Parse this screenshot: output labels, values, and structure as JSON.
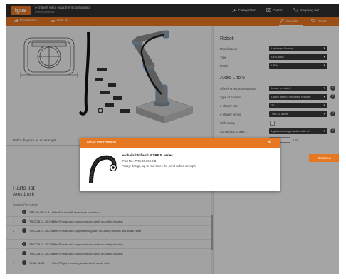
{
  "header": {
    "logo": "igus",
    "title": "e-chain® robot equipment configurator",
    "subtitle": "motion plastics®",
    "links": [
      {
        "icon": "wrench-icon",
        "label": "Configuration"
      },
      {
        "icon": "mail-icon",
        "label": "Contact"
      },
      {
        "icon": "cart-icon",
        "label": "Shopping cart"
      }
    ],
    "menu_icon": "⋮"
  },
  "toolbar": {
    "visualisation": "Visualisation",
    "parts_list": "Parts list",
    "selection": "Selection",
    "result": "Result"
  },
  "left": {
    "diagram_caption": "Robot diagram as an example",
    "parts_title": "Parts list",
    "parts_subtitle": "Axes 1 to 6",
    "table_header": "Quantity Part number",
    "rows": [
      {
        "qty": "1",
        "part": "TRE.30.090.0.B",
        "desc": "triflex® e-chain® resistance to torsion",
        "size": "two"
      },
      {
        "qty": "1",
        "part": "TR.COB.01.30.22.0",
        "desc": "triflex® hook-and-loop connection with mounting bracket"
      },
      {
        "qty": "2",
        "part": "TR.COB.01.30.22.0",
        "desc": "triflex® hook-and-loop fastening with mounting bracket and strain relief"
      },
      {
        "qty": "1",
        "part": "TR.COB.01.30.22.0",
        "desc": "triflex® hook-and-loop connection with mounting bracket"
      },
      {
        "qty": "1",
        "part": "TR.COB.01.30.22.0",
        "desc": "triflex® hook-and-loop connection with mounting bracket"
      },
      {
        "qty": "1",
        "part": "TL.30.01.23",
        "desc": "triflex® light mounting bracket with strain relief"
      }
    ]
  },
  "right": {
    "robot_title": "Robot",
    "manufacturer_label": "Manufacturer",
    "manufacturer_value": "Universal Robots",
    "type_label": "Type",
    "type_value": "UR Cobot",
    "model_label": "Model",
    "model_value": "UR5e",
    "axes_title": "Axes 1 to 6",
    "retraction_label": "triflex® R retraction system",
    "retraction_value": "Loose e-chain®",
    "bracket_label": "Type of bracket",
    "bracket_value": "Cobot clamp, mounting bracket",
    "size_label": "e-chain® size",
    "size_value": "30",
    "series_label": "e-chain® series",
    "series_value": "TRE.B series",
    "clamp_label": "With clamp",
    "connection_label": "Connection to axis 1",
    "connection_value": "Light mounting bracket with st...",
    "unit_label": "Unit",
    "continue": "Continue"
  },
  "modal": {
    "title": "More information",
    "product_title": "e-chain® triflex® R TRE.B series",
    "part_no": "Part No.: TRE.30.090.0.B",
    "description": "\"easy\" design, up to four times the bend radius strength."
  }
}
